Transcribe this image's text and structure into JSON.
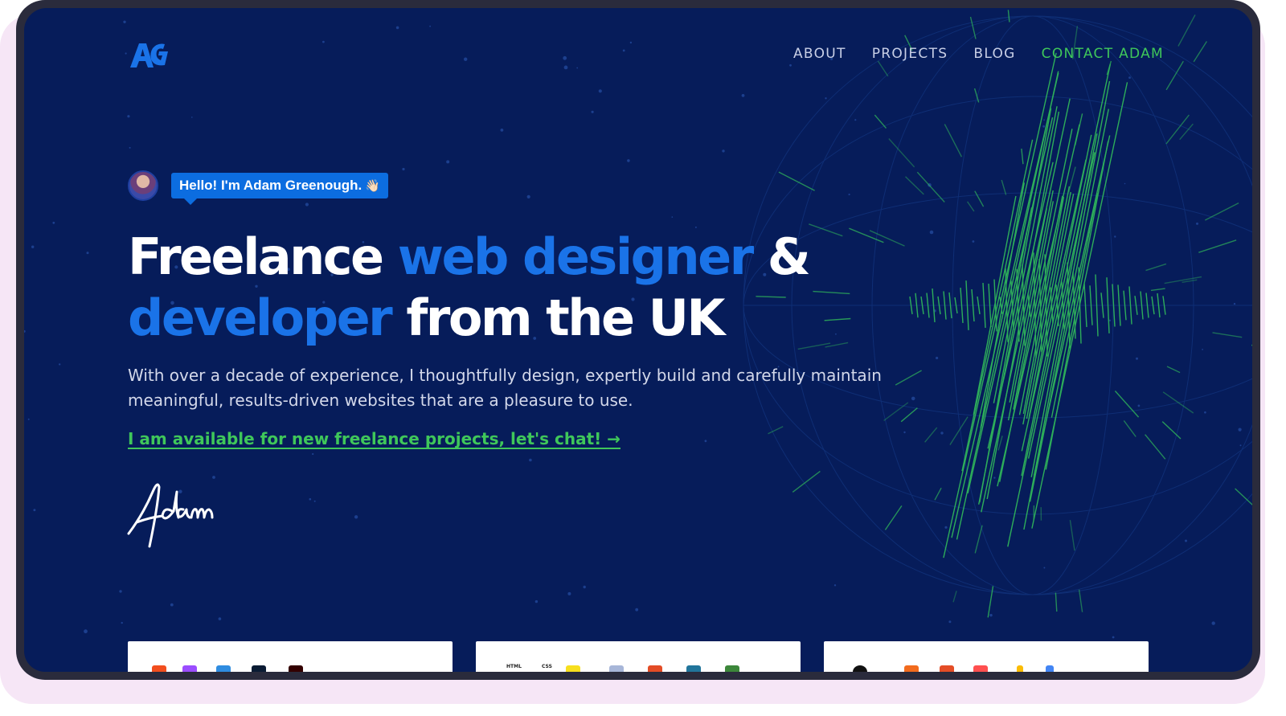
{
  "header": {
    "logo_alt": "AG",
    "nav": [
      {
        "label": "ABOUT"
      },
      {
        "label": "PROJECTS"
      },
      {
        "label": "BLOG"
      },
      {
        "label": "CONTACT ADAM"
      }
    ]
  },
  "hero": {
    "greeting": "Hello! I'm Adam Greenough.",
    "greeting_emoji": "👋🏻",
    "headline": {
      "part1": "Freelance ",
      "part2_blue": "web designer",
      "part3": " &",
      "part4_blue": "developer",
      "part5": " from the UK"
    },
    "lede": "With over a decade of experience, I thoughtfully design, expertly build and carefully maintain meaningful, results-driven websites that are a pleasure to use.",
    "cta": "I am available for new freelance projects, let's chat! →",
    "signature": "Adam"
  },
  "cards": {
    "card2": {
      "html_label": "HTML",
      "css_label": "CSS"
    }
  },
  "colors": {
    "background": "#061c5a",
    "accent_blue": "#1a73e8",
    "accent_green": "#3fc75a",
    "frame": "#2a2b3c"
  }
}
